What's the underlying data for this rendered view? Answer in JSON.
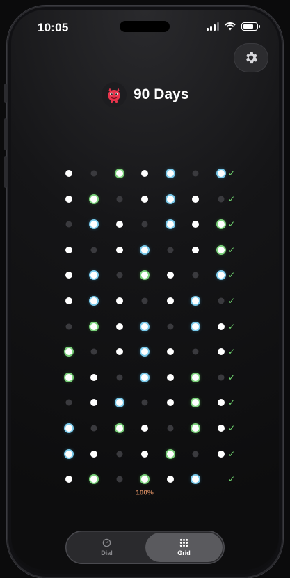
{
  "status": {
    "time": "10:05"
  },
  "header": {
    "title": "90 Days",
    "avatar_icon": "red-monster-icon",
    "settings_icon": "gear-icon"
  },
  "grid": {
    "columns": 7,
    "rows": [
      [
        "white",
        "dim",
        "green",
        "white",
        "blue",
        "dim",
        "blue"
      ],
      [
        "white",
        "green",
        "dim",
        "white",
        "blue",
        "white",
        "dim"
      ],
      [
        "dim",
        "blue",
        "white",
        "dim",
        "blue",
        "white",
        "green"
      ],
      [
        "white",
        "dim",
        "white",
        "blue",
        "dim",
        "white",
        "green"
      ],
      [
        "white",
        "blue",
        "dim",
        "green",
        "white",
        "dim",
        "blue"
      ],
      [
        "white",
        "blue",
        "white",
        "dim",
        "white",
        "blue",
        "dim"
      ],
      [
        "dim",
        "green",
        "white",
        "blue",
        "dim",
        "blue",
        "white"
      ],
      [
        "green",
        "dim",
        "white",
        "blue",
        "white",
        "dim",
        "white"
      ],
      [
        "green",
        "white",
        "dim",
        "blue",
        "white",
        "green",
        "dim"
      ],
      [
        "dim",
        "white",
        "blue",
        "dim",
        "white",
        "green",
        "white"
      ],
      [
        "blue",
        "dim",
        "green",
        "white",
        "dim",
        "green",
        "white"
      ],
      [
        "blue",
        "white",
        "dim",
        "white",
        "green",
        "dim",
        "white"
      ],
      [
        "white",
        "green",
        "dim",
        "green",
        "white",
        "blue",
        "none"
      ]
    ],
    "row_completed": [
      true,
      true,
      true,
      true,
      true,
      true,
      true,
      true,
      true,
      true,
      true,
      true,
      true
    ],
    "progress_label": "100%",
    "progress": 1.0
  },
  "colors": {
    "accent_green": "#6fd36f",
    "accent_blue": "#79c9ea",
    "progress_text": "#c8835a"
  },
  "tabs": [
    {
      "label": "Dial",
      "icon": "dial-icon",
      "selected": false
    },
    {
      "label": "Grid",
      "icon": "grid-icon",
      "selected": true
    }
  ]
}
